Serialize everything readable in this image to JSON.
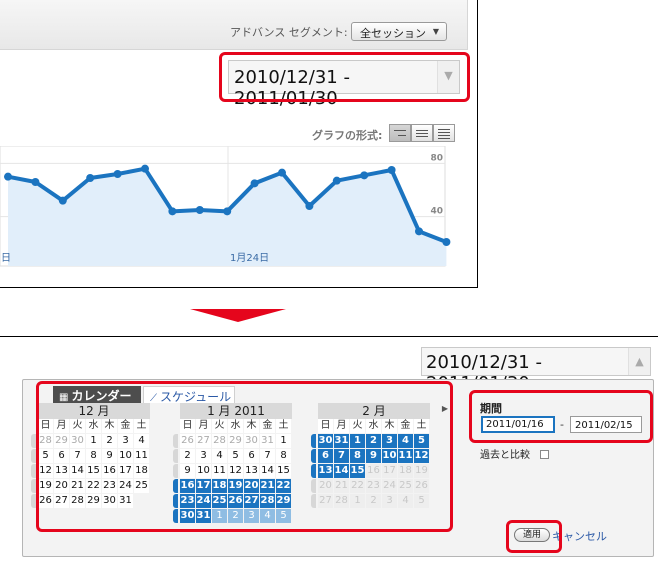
{
  "segment": {
    "label": "アドバンス セグメント:",
    "value": "全セッション"
  },
  "date_range": {
    "value": "2010/12/31 - 2011/01/30"
  },
  "graph_type": {
    "label": "グラフの形式:"
  },
  "chart_data": {
    "type": "line",
    "y_ticks": [
      40,
      80
    ],
    "x_labels": [
      "日",
      "1月24日"
    ],
    "ylim": [
      0,
      90
    ],
    "values": [
      70,
      66,
      52,
      69,
      72,
      76,
      44,
      45,
      44,
      65,
      73,
      48,
      67,
      71,
      75,
      29,
      21
    ],
    "grid": true,
    "color": "#1b74c0",
    "fill": "#e1eefa"
  },
  "picker": {
    "tabs": {
      "calendar": "カレンダー",
      "schedule": "スケジュール"
    },
    "dow": [
      "日",
      "月",
      "火",
      "水",
      "木",
      "金",
      "土"
    ],
    "months": [
      {
        "title": "12 月",
        "weeks": [
          [
            [
              "28",
              "out"
            ],
            [
              "29",
              "out"
            ],
            [
              "30",
              "out"
            ],
            [
              "1",
              "cur"
            ],
            [
              "2",
              "cur"
            ],
            [
              "3",
              "cur"
            ],
            [
              "4",
              "cur"
            ]
          ],
          [
            [
              "5",
              "cur"
            ],
            [
              "6",
              "cur"
            ],
            [
              "7",
              "cur"
            ],
            [
              "8",
              "cur"
            ],
            [
              "9",
              "cur"
            ],
            [
              "10",
              "cur"
            ],
            [
              "11",
              "cur"
            ]
          ],
          [
            [
              "12",
              "cur"
            ],
            [
              "13",
              "cur"
            ],
            [
              "14",
              "cur"
            ],
            [
              "15",
              "cur"
            ],
            [
              "16",
              "cur"
            ],
            [
              "17",
              "cur"
            ],
            [
              "18",
              "cur"
            ]
          ],
          [
            [
              "19",
              "cur"
            ],
            [
              "20",
              "cur"
            ],
            [
              "21",
              "cur"
            ],
            [
              "22",
              "cur"
            ],
            [
              "23",
              "cur"
            ],
            [
              "24",
              "cur"
            ],
            [
              "25",
              "cur"
            ]
          ],
          [
            [
              "26",
              "cur"
            ],
            [
              "27",
              "cur"
            ],
            [
              "28",
              "cur"
            ],
            [
              "29",
              "cur"
            ],
            [
              "30",
              "cur"
            ],
            [
              "31",
              "cur"
            ],
            [
              "",
              ""
            ]
          ]
        ]
      },
      {
        "title": "1 月 2011",
        "weeks": [
          [
            [
              "26",
              "out"
            ],
            [
              "27",
              "out"
            ],
            [
              "28",
              "out"
            ],
            [
              "29",
              "out"
            ],
            [
              "30",
              "out"
            ],
            [
              "31",
              "out"
            ],
            [
              "1",
              "cur"
            ]
          ],
          [
            [
              "2",
              "cur"
            ],
            [
              "3",
              "cur"
            ],
            [
              "4",
              "cur"
            ],
            [
              "5",
              "cur"
            ],
            [
              "6",
              "cur"
            ],
            [
              "7",
              "cur"
            ],
            [
              "8",
              "cur"
            ]
          ],
          [
            [
              "9",
              "cur"
            ],
            [
              "10",
              "cur"
            ],
            [
              "11",
              "cur"
            ],
            [
              "12",
              "cur"
            ],
            [
              "13",
              "cur"
            ],
            [
              "14",
              "cur"
            ],
            [
              "15",
              "cur"
            ]
          ],
          [
            [
              "16",
              "sel"
            ],
            [
              "17",
              "sel"
            ],
            [
              "18",
              "sel"
            ],
            [
              "19",
              "sel"
            ],
            [
              "20",
              "sel"
            ],
            [
              "21",
              "sel"
            ],
            [
              "22",
              "sel"
            ]
          ],
          [
            [
              "23",
              "sel"
            ],
            [
              "24",
              "sel"
            ],
            [
              "25",
              "sel"
            ],
            [
              "26",
              "sel"
            ],
            [
              "27",
              "sel"
            ],
            [
              "28",
              "sel"
            ],
            [
              "29",
              "sel"
            ]
          ],
          [
            [
              "30",
              "sel"
            ],
            [
              "31",
              "sel"
            ],
            [
              "1",
              "cmp"
            ],
            [
              "2",
              "cmp"
            ],
            [
              "3",
              "cmp"
            ],
            [
              "4",
              "cmp"
            ],
            [
              "5",
              "cmp"
            ]
          ]
        ]
      },
      {
        "title": "2 月",
        "weeks": [
          [
            [
              "30",
              "sel"
            ],
            [
              "31",
              "sel"
            ],
            [
              "1",
              "sel"
            ],
            [
              "2",
              "sel"
            ],
            [
              "3",
              "sel"
            ],
            [
              "4",
              "sel"
            ],
            [
              "5",
              "sel"
            ]
          ],
          [
            [
              "6",
              "sel"
            ],
            [
              "7",
              "sel"
            ],
            [
              "8",
              "sel"
            ],
            [
              "9",
              "sel"
            ],
            [
              "10",
              "sel"
            ],
            [
              "11",
              "sel"
            ],
            [
              "12",
              "sel"
            ]
          ],
          [
            [
              "13",
              "sel"
            ],
            [
              "14",
              "sel"
            ],
            [
              "15",
              "sel"
            ],
            [
              "16",
              "dis"
            ],
            [
              "17",
              "dis"
            ],
            [
              "18",
              "dis"
            ],
            [
              "19",
              "dis"
            ]
          ],
          [
            [
              "20",
              "dis"
            ],
            [
              "21",
              "dis"
            ],
            [
              "22",
              "dis"
            ],
            [
              "23",
              "dis"
            ],
            [
              "24",
              "dis"
            ],
            [
              "25",
              "dis"
            ],
            [
              "26",
              "dis"
            ]
          ],
          [
            [
              "27",
              "dis"
            ],
            [
              "28",
              "dis"
            ],
            [
              "1",
              "dis"
            ],
            [
              "2",
              "dis"
            ],
            [
              "3",
              "dis"
            ],
            [
              "4",
              "dis"
            ],
            [
              "5",
              "dis"
            ]
          ]
        ]
      }
    ]
  },
  "period": {
    "label": "期間",
    "start": "2011/01/16",
    "end": "2011/02/15",
    "separator": "-",
    "compare_label": "過去と比較"
  },
  "actions": {
    "apply": "適用",
    "cancel": "キャンセル"
  }
}
